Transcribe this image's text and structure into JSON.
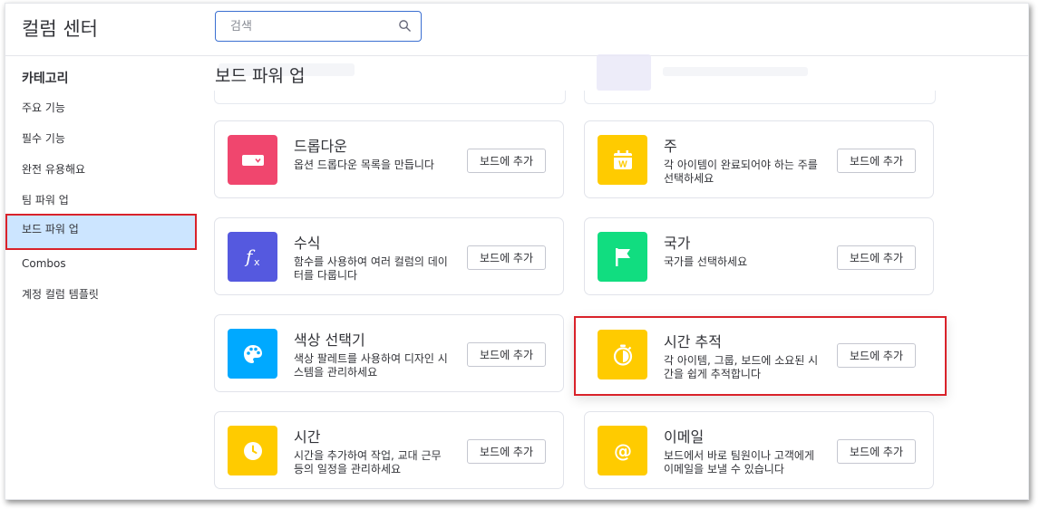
{
  "header": {
    "title": "컬럼 센터",
    "search_placeholder": "검색"
  },
  "sidebar": {
    "heading": "카테고리",
    "items": [
      {
        "label": "주요 기능"
      },
      {
        "label": "필수 기능"
      },
      {
        "label": "완전 유용해요"
      },
      {
        "label": "팀 파워 업"
      },
      {
        "label": "보드 파워 업",
        "active": true
      },
      {
        "label": "Combos"
      },
      {
        "label": "계정 컬럼 템플릿"
      }
    ]
  },
  "main": {
    "section_title": "보드 파워 업",
    "add_label": "보드에 추가",
    "cards": [
      {
        "name": "드롭다운",
        "desc": "옵션 드롭다운 목록을 만듭니다",
        "icon": "dropdown-icon",
        "color": "#f0466e"
      },
      {
        "name": "주",
        "desc": "각 아이템이 완료되어야 하는 주를 선택하세요",
        "icon": "calendar-week-icon",
        "color": "#ffcb00"
      },
      {
        "name": "수식",
        "desc": "함수를 사용하여 여러 컬럼의 데이터를 다룹니다",
        "icon": "formula-icon",
        "color": "#5559df"
      },
      {
        "name": "국가",
        "desc": "국가를 선택하세요",
        "icon": "flag-icon",
        "color": "#11dd80"
      },
      {
        "name": "색상 선택기",
        "desc": "색상 팔레트를 사용하여 디자인 시스템을 관리하세요",
        "icon": "palette-icon",
        "color": "#00a9ff"
      },
      {
        "name": "시간 추적",
        "desc": "각 아이템, 그룹, 보드에 소요된 시간을 쉽게 추적합니다",
        "icon": "stopwatch-icon",
        "color": "#ffcb00"
      },
      {
        "name": "시간",
        "desc": "시간을 추가하여 작업, 교대 근무 등의 일정을 관리하세요",
        "icon": "clock-icon",
        "color": "#ffcb00"
      },
      {
        "name": "이메일",
        "desc": "보드에서 바로 팀원이나 고객에게 이메일을 보낼 수 있습니다",
        "icon": "at-sign-icon",
        "color": "#ffcb00"
      }
    ]
  }
}
